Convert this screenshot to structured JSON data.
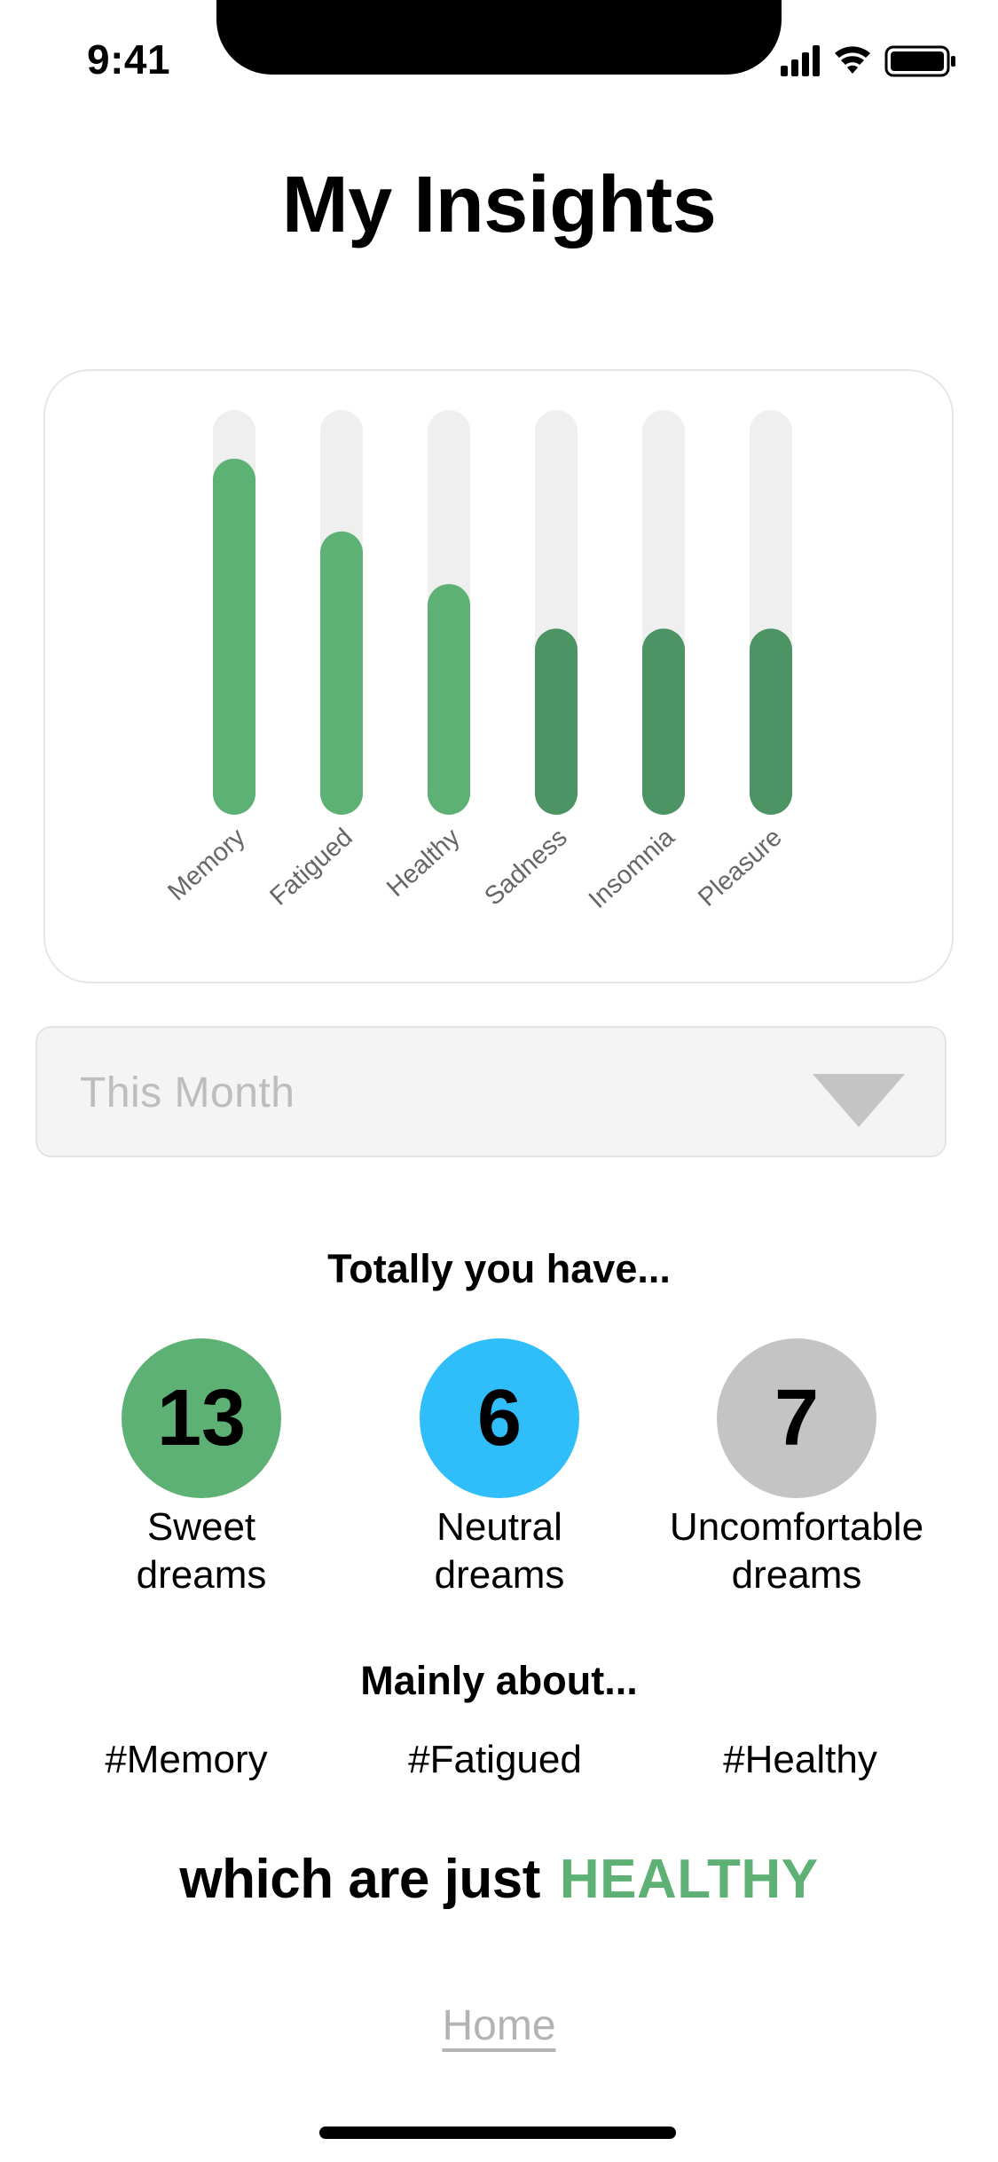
{
  "status_bar": {
    "time": "9:41",
    "icons": [
      "signal-icon",
      "wifi-icon",
      "battery-icon"
    ]
  },
  "header": {
    "title": "My Insights"
  },
  "chart_data": {
    "type": "bar",
    "categories": [
      "Memory",
      "Fatigued",
      "Healthy",
      "Sadness",
      "Insomnia",
      "Pleasure"
    ],
    "values": [
      88,
      70,
      57,
      46,
      46,
      46
    ],
    "ylim": [
      0,
      100
    ],
    "grid": false,
    "colors": [
      "#5db174",
      "#5db174",
      "#5db174",
      "#4c9464",
      "#4c9464",
      "#4c9464"
    ],
    "track_color": "#efefef"
  },
  "period": {
    "selected": "This Month"
  },
  "summary": {
    "heading": "Totally you have...",
    "dreams": [
      {
        "count": "13",
        "label_line1": "Sweet",
        "label_line2": "dreams",
        "color": "#5db174"
      },
      {
        "count": "6",
        "label_line1": "Neutral",
        "label_line2": "dreams",
        "color": "#2fbefa"
      },
      {
        "count": "7",
        "label_line1": "Uncomfortable",
        "label_line2": "dreams",
        "color": "#c4c4c4"
      }
    ]
  },
  "topics": {
    "heading": "Mainly about...",
    "tags": [
      "#Memory",
      "#Fatigued",
      "#Healthy"
    ]
  },
  "conclusion": {
    "prefix": "which are just",
    "highlight": "HEALTHY",
    "highlight_color": "#5db174"
  },
  "footer": {
    "home_label": "Home"
  }
}
